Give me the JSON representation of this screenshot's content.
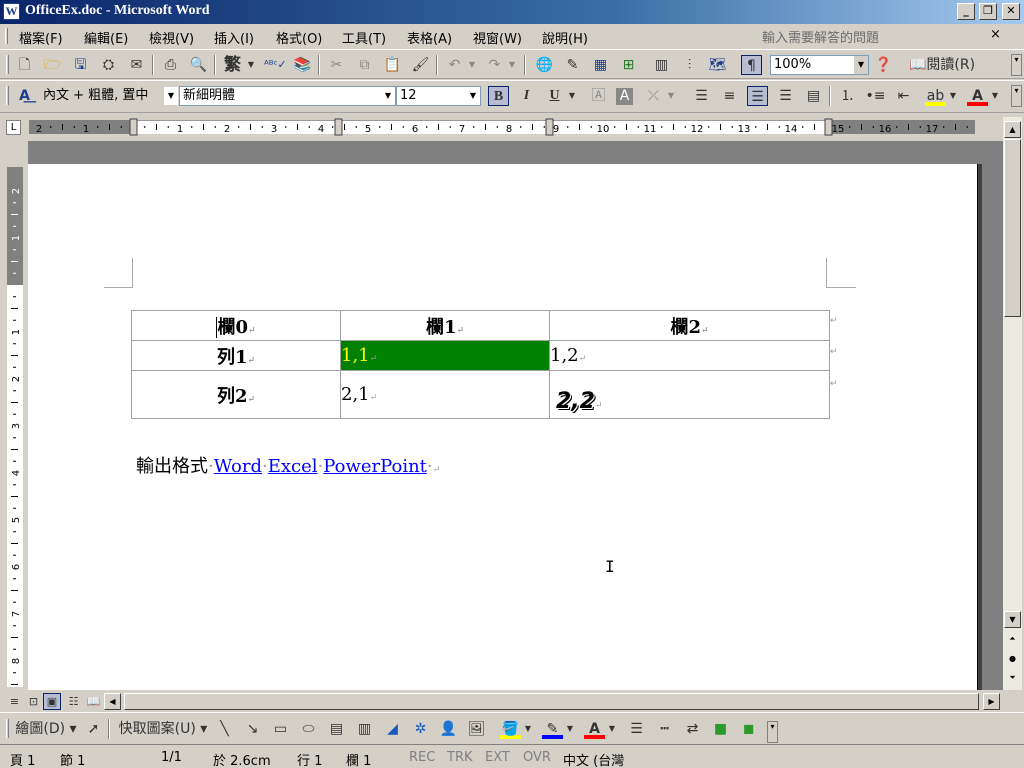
{
  "window": {
    "title": "OfficeEx.doc - Microsoft Word",
    "icon": "W"
  },
  "menu": {
    "items": [
      "檔案(F)",
      "編輯(E)",
      "檢視(V)",
      "插入(I)",
      "格式(O)",
      "工具(T)",
      "表格(A)",
      "視窗(W)",
      "說明(H)"
    ],
    "help_placeholder": "輸入需要解答的問題",
    "close_symbol": "×"
  },
  "standard_toolbar": {
    "traditional_label": "繁",
    "zoom": "100%",
    "read_label": "閱讀(R)"
  },
  "formatting_toolbar": {
    "style": "內文 + 粗體, 置中",
    "font": "新細明體",
    "size": "12",
    "bold_label": "B",
    "italic_label": "I",
    "underline_label": "U"
  },
  "ruler": {
    "h_ticks": [
      "2",
      "1",
      "1",
      "2",
      "3",
      "4",
      "5",
      "6",
      "7",
      "8",
      "9",
      "10",
      "11",
      "12",
      "13",
      "14",
      "15",
      "16",
      "17"
    ],
    "v_ticks": [
      "2",
      "1",
      "1",
      "2",
      "3",
      "4",
      "5",
      "6",
      "7",
      "8"
    ]
  },
  "document": {
    "table": [
      [
        "欄0",
        "欄1",
        "欄2"
      ],
      [
        "列1",
        "1,1",
        "1,2"
      ],
      [
        "列2",
        "2,1",
        "2,2"
      ]
    ],
    "cell_1_1": {
      "bg": "#008000",
      "fg": "#ffff00"
    },
    "paragraph_label": "輸出格式",
    "links": [
      "Word",
      "Excel",
      "PowerPoint"
    ],
    "para_mark": "↵"
  },
  "drawing_toolbar": {
    "draw_label": "繪圖(D)",
    "autoshapes_label": "快取圖案(U)"
  },
  "status": {
    "page": "頁 1",
    "section": "節 1",
    "pages": "1/1",
    "at": "於 2.6cm",
    "line": "行 1",
    "col": "欄 1",
    "rec": "REC",
    "trk": "TRK",
    "ext": "EXT",
    "ovr": "OVR",
    "lang": "中文 (台灣"
  }
}
